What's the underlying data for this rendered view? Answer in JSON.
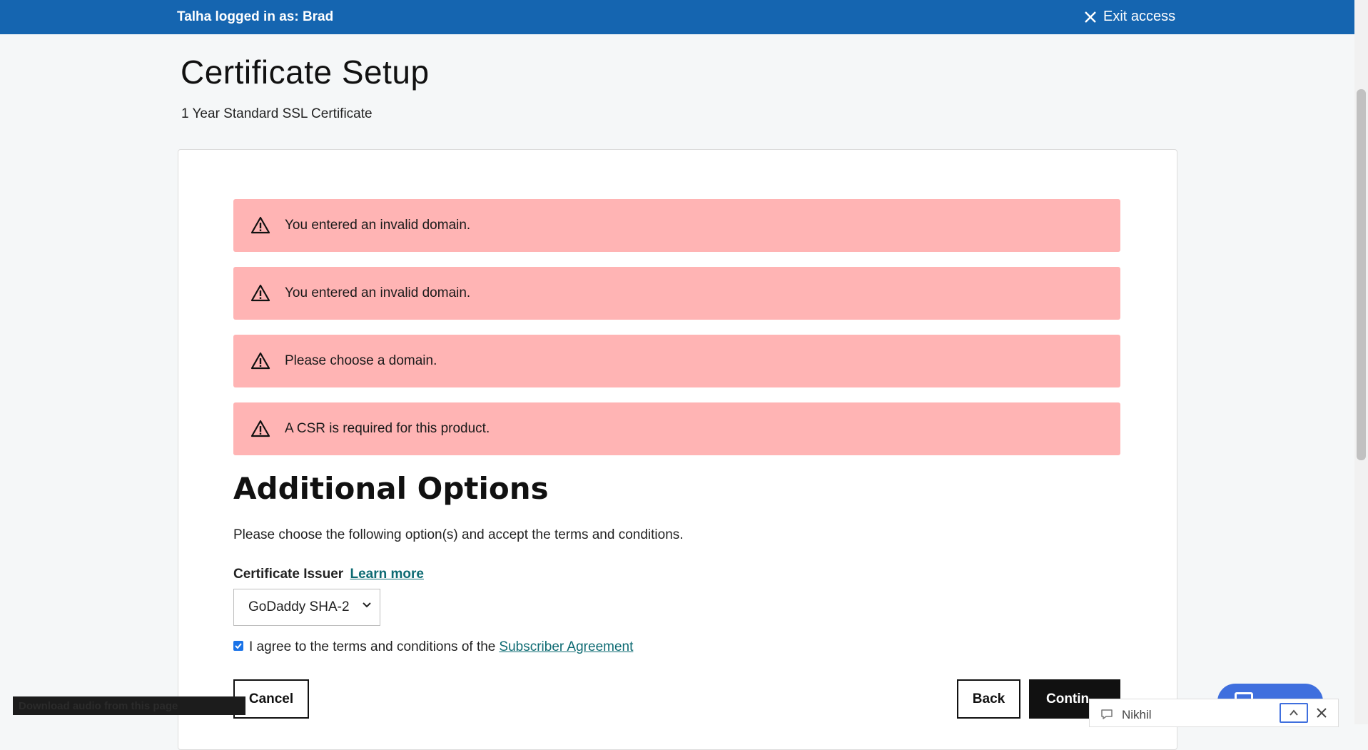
{
  "topbar": {
    "logged_in_text": "Talha logged in as: Brad",
    "exit_label": "Exit access"
  },
  "page": {
    "title": "Certificate Setup",
    "subtitle": "1 Year Standard SSL Certificate"
  },
  "alerts": [
    {
      "message": "You entered an invalid domain."
    },
    {
      "message": "You entered an invalid domain."
    },
    {
      "message": "Please choose a domain."
    },
    {
      "message": "A CSR is required for this product."
    }
  ],
  "options": {
    "heading": "Additional Options",
    "description": "Please choose the following option(s) and accept the terms and conditions.",
    "issuer_label": "Certificate Issuer",
    "learn_more": "Learn more",
    "issuer_selected": "GoDaddy SHA-2",
    "agree_text": "I agree to the terms and conditions of the",
    "agreement_link": "Subscriber Agreement",
    "agree_checked": true
  },
  "buttons": {
    "cancel": "Cancel",
    "back": "Back",
    "continue": "Contin"
  },
  "overlays": {
    "audio_text": "Download audio from this page",
    "chat_agent": "Nikhil"
  },
  "colors": {
    "topbar": "#1565b0",
    "alert_bg": "#ffb4b4",
    "link": "#0e6b73",
    "chat_accent": "#3f6fde"
  }
}
